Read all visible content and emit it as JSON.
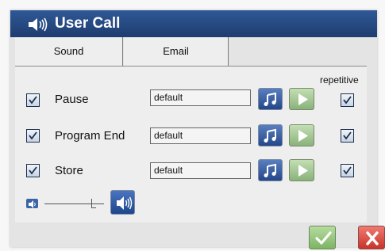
{
  "window": {
    "title": "User Call",
    "title_icon": "speaker-icon"
  },
  "tabs": [
    {
      "label": "Sound",
      "active": true
    },
    {
      "label": "Email",
      "active": false
    }
  ],
  "columns": {
    "repetitive_label": "repetitive"
  },
  "rows": [
    {
      "label": "Pause",
      "enabled": true,
      "sound": "default",
      "repetitive": true
    },
    {
      "label": "Program End",
      "enabled": true,
      "sound": "default",
      "repetitive": true
    },
    {
      "label": "Store",
      "enabled": true,
      "sound": "default",
      "repetitive": true
    }
  ],
  "volume": {
    "min_icon": "volume-low-icon",
    "max_icon": "volume-high-icon",
    "level": 0.78
  },
  "footer": {
    "ok_icon": "checkmark-icon",
    "cancel_icon": "close-icon"
  },
  "colors": {
    "title_bar": "#2a4f8a",
    "accent_blue": "#24478a",
    "play_green": "#89b27a",
    "cancel_red": "#c8332a"
  }
}
